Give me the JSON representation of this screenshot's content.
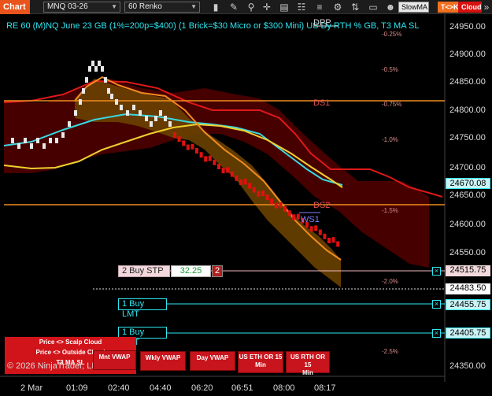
{
  "toolbar": {
    "chart_tab": "Chart",
    "instrument": "MNQ 03-26",
    "bar_type": "60 Renko",
    "slowma": "SlowMA",
    "tck_label": "T<>K",
    "cloud_label": "Cloud"
  },
  "chart": {
    "title": "RE 60 (M)NQ June 23 GB (1%=200p=$400) (1 Brick=$30 Micro or $300 Mini) US Dy RTH % GB, T3 MA SL",
    "dpp_label": "DPP",
    "ds1_label": "DS1",
    "ds2_label": "DS2",
    "ws1_label": "WS1",
    "pct_levels": [
      "-0.25%",
      "-0.5%",
      "-0.75%",
      "-1.0%",
      "-1.5%",
      "-2.0%",
      "-2.5%"
    ],
    "y_axis": [
      "24950.00",
      "24900.00",
      "24850.00",
      "24800.00",
      "24750.00",
      "24700.00",
      "24650.00",
      "24600.00",
      "24550.00",
      "24350.00"
    ],
    "x_axis": [
      "2 Mar",
      "01:09",
      "02:40",
      "04:40",
      "06:20",
      "06:51",
      "08:00",
      "08:17"
    ],
    "price_tags": {
      "current_high": "24670.08",
      "stop": "24515.75",
      "last": "24483.50",
      "lmt1": "24455.75",
      "lmt2": "24405.75"
    }
  },
  "orders": {
    "stop_label": "2 Buy STP",
    "stop_value": "32.25",
    "stop_qty": "2",
    "lmt1_label": "1 Buy LMT",
    "lmt2_label": "1 Buy LMT",
    "close_glyph": "×"
  },
  "panel": {
    "line1": "Price <> Scalp Cloud",
    "line2": "Price <> Outside Cloud",
    "line3": "T3 MA SL",
    "copyright": "© 2026 NinjaTrader, LLC"
  },
  "vwap_buttons": [
    {
      "l1": "Mnt VWAP",
      "l2": ""
    },
    {
      "l1": "Wkly VWAP",
      "l2": ""
    },
    {
      "l1": "Day VWAP",
      "l2": ""
    },
    {
      "l1": "US ETH OR 15",
      "l2": "Min"
    },
    {
      "l1": "US RTH OR 15",
      "l2": "Min"
    }
  ],
  "colors": {
    "accent_orange": "#e8541b",
    "cyan": "#2fe6f0",
    "red_cloud": "#6a0000",
    "orange_cloud": "#7a4a00",
    "brick_red": "#e01010",
    "brick_white": "#e8e8e8"
  }
}
